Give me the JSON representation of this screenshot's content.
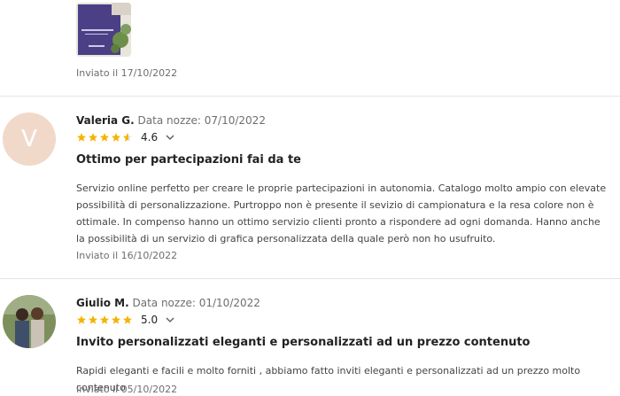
{
  "reviews": [
    {
      "sent": "Inviato il 17/10/2022"
    },
    {
      "name": "Valeria G.",
      "wedding_date": "Data nozze: 07/10/2022",
      "avatar_letter": "V",
      "rating": "4.6",
      "title": "Ottimo per partecipazioni fai da te",
      "body": "Servizio online perfetto per creare le proprie partecipazioni in autonomia. Catalogo molto ampio con elevate possibilità di personalizzazione. Purtroppo non è presente il sevizio di campionatura e la resa colore non è ottimale. In compenso hanno un ottimo servizio clienti pronto a rispondere ad ogni domanda. Hanno anche la possibilità di un servizio di grafica personalizzata della quale però non ho usufruito.",
      "sent": "Inviato il 16/10/2022"
    },
    {
      "name": "Giulio M.",
      "wedding_date": "Data nozze: 01/10/2022",
      "rating": "5.0",
      "title": "Invito personalizzati eleganti e personalizzati ad un prezzo contenuto",
      "body": "Rapidi eleganti e facili e molto forniti , abbiamo fatto inviti eleganti e personalizzati ad un prezzo molto contenuto",
      "sent": "Inviato il 05/10/2022"
    }
  ],
  "colors": {
    "star": "#f5b301",
    "avatar_bg": "#f1d9c9",
    "divider": "#e4e4e4"
  },
  "icons": {
    "star": "star-icon",
    "chevron": "chevron-down-icon"
  }
}
